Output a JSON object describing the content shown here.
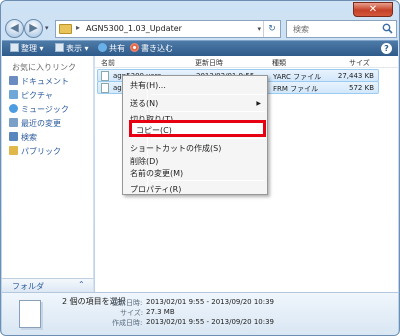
{
  "window": {
    "close_label": "✕"
  },
  "address": {
    "path": "AGN5300_1.03_Updater",
    "separator": "▸"
  },
  "search": {
    "placeholder": "検索"
  },
  "toolbar": {
    "organize": "整理 ▾",
    "view": "表示 ▾",
    "share": "共有",
    "burn": "書き込む",
    "help": "?"
  },
  "sidebar": {
    "favorites": "お気に入りリンク",
    "items": [
      {
        "label": "ドキュメント",
        "icon": "documents-icon",
        "color": "#6b8cc0"
      },
      {
        "label": "ピクチャ",
        "icon": "pictures-icon",
        "color": "#6fa8d8"
      },
      {
        "label": "ミュージック",
        "icon": "music-icon",
        "color": "#4d9be0"
      },
      {
        "label": "最近の変更",
        "icon": "recent-icon",
        "color": "#7aa0c8"
      },
      {
        "label": "検索",
        "icon": "search-folder-icon",
        "color": "#5a86be"
      },
      {
        "label": "パブリック",
        "icon": "public-folder-icon",
        "color": "#e0b84a"
      }
    ],
    "folders_label": "フォルダ"
  },
  "columns": {
    "name": "名前",
    "date": "更新日時",
    "type": "種類",
    "size": "サイズ"
  },
  "files": [
    {
      "name": "agn5300.yarc",
      "date": "2013/02/01 9:55",
      "type": "YARC ファイル",
      "size": "27,443 KB"
    },
    {
      "name": "agn5300.frm",
      "date": "",
      "type": "FRM ファイル",
      "size": "572 KB"
    }
  ],
  "context_menu": [
    {
      "label": "共有(H)...",
      "submenu": false
    },
    {
      "label": "送る(N)",
      "submenu": true
    },
    {
      "label": "切り取り(T)",
      "submenu": false
    },
    {
      "label": "コピー(C)",
      "submenu": false
    },
    {
      "label": "ショートカットの作成(S)",
      "submenu": false
    },
    {
      "label": "削除(D)",
      "submenu": false
    },
    {
      "label": "名前の変更(M)",
      "submenu": false
    },
    {
      "label": "プロパティ(R)",
      "submenu": false
    }
  ],
  "details": {
    "selection": "2 個の項目を選択",
    "modified_label": "更新日時:",
    "modified_value": "2013/02/01 9:55 - 2013/09/20 10:39",
    "size_label": "サイズ:",
    "size_value": "27.3 MB",
    "created_label": "作成日時:",
    "created_value": "2013/02/01 9:55 - 2013/09/20 10:39"
  },
  "colors": {
    "highlight_border": "#e60012",
    "toolbar": "#2f5b8a",
    "link": "#2a5a9c"
  }
}
